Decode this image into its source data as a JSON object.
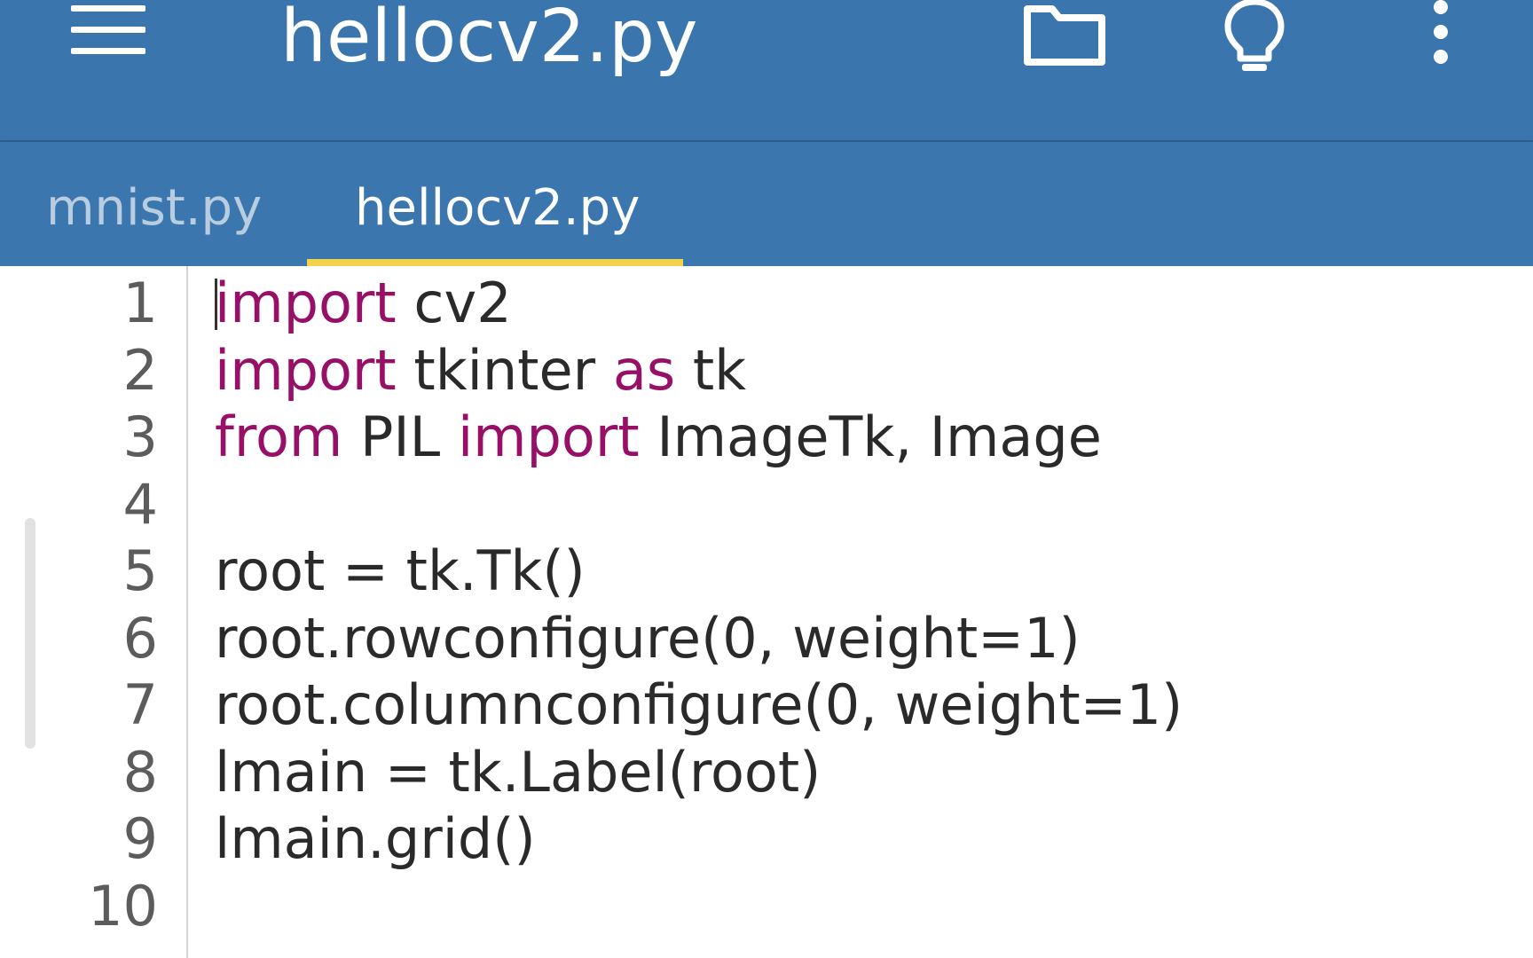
{
  "appbar": {
    "title": "hellocv2.py",
    "actions": [
      "folder-icon",
      "lightbulb-icon",
      "more-vert-icon"
    ]
  },
  "tabs": [
    {
      "label": "mnist.py",
      "active": false
    },
    {
      "label": "hellocv2.py",
      "active": true
    }
  ],
  "editor": {
    "lines": [
      {
        "num": "1",
        "segments": [
          {
            "t": "import",
            "kw": true
          },
          {
            "t": " cv2",
            "kw": false
          }
        ]
      },
      {
        "num": "2",
        "segments": [
          {
            "t": "import",
            "kw": true
          },
          {
            "t": " tkinter ",
            "kw": false
          },
          {
            "t": "as",
            "kw": true
          },
          {
            "t": " tk",
            "kw": false
          }
        ]
      },
      {
        "num": "3",
        "segments": [
          {
            "t": "from",
            "kw": true
          },
          {
            "t": " PIL ",
            "kw": false
          },
          {
            "t": "import",
            "kw": true
          },
          {
            "t": " ImageTk, Image",
            "kw": false
          }
        ]
      },
      {
        "num": "4",
        "segments": []
      },
      {
        "num": "5",
        "segments": [
          {
            "t": "root = tk.Tk()",
            "kw": false
          }
        ]
      },
      {
        "num": "6",
        "segments": [
          {
            "t": "root.rowconfigure(0, weight=1)",
            "kw": false
          }
        ]
      },
      {
        "num": "7",
        "segments": [
          {
            "t": "root.columnconfigure(0, weight=1)",
            "kw": false
          }
        ]
      },
      {
        "num": "8",
        "segments": [
          {
            "t": "lmain = tk.Label(root)",
            "kw": false
          }
        ]
      },
      {
        "num": "9",
        "segments": [
          {
            "t": "lmain.grid()",
            "kw": false
          }
        ]
      },
      {
        "num": "10",
        "segments": []
      }
    ]
  },
  "colors": {
    "appbar": "#3a76ad",
    "tab_indicator": "#f2d14b",
    "keyword": "#970f66"
  }
}
